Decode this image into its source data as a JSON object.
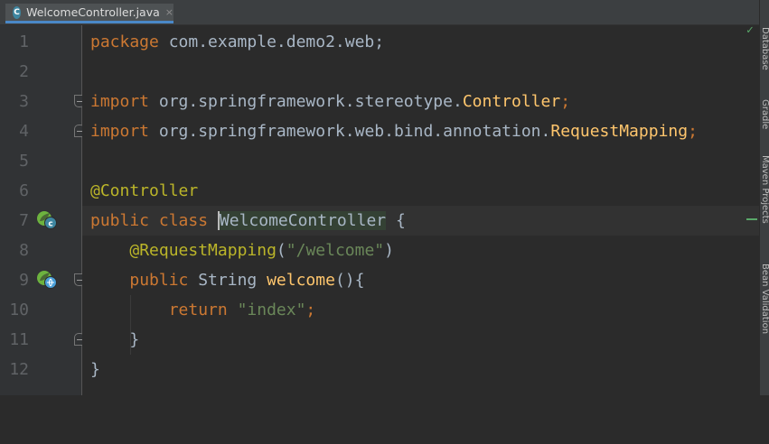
{
  "tab": {
    "icon_letter": "C",
    "file_name": "WelcomeController.java",
    "close_glyph": "×"
  },
  "gutter": {
    "line_numbers": [
      "1",
      "2",
      "3",
      "4",
      "5",
      "6",
      "7",
      "8",
      "9",
      "10",
      "11",
      "12"
    ]
  },
  "code": {
    "l1_kw": "package",
    "l1_rest": " com.example.demo2.web;",
    "l3_kw": "import",
    "l3_pkg": " org.springframework.stereotype.",
    "l3_cls": "Controller",
    "l3_semi": ";",
    "l4_kw": "import",
    "l4_pkg": " org.springframework.web.bind.annotation.",
    "l4_cls": "RequestMapping",
    "l4_semi": ";",
    "l6_ann": "@Controller",
    "l7_kw": "public class ",
    "l7_name": "WelcomeController",
    "l7_brace": " {",
    "l8_indent": "    ",
    "l8_ann": "@RequestMapping",
    "l8_open": "(",
    "l8_str": "\"/welcome\"",
    "l8_close": ")",
    "l9_indent": "    ",
    "l9_kw": "public ",
    "l9_type": "String ",
    "l9_fn": "welcome",
    "l9_rest": "(){",
    "l10_indent": "        ",
    "l10_kw": "return ",
    "l10_str": "\"index\"",
    "l10_semi": ";",
    "l11_text": "    }",
    "l12_text": "}"
  },
  "right_panel": {
    "tabs": [
      "Database",
      "Gradle",
      "Maven Projects",
      "Bean Validation"
    ]
  },
  "status": {
    "check_glyph": "✓"
  },
  "colors": {
    "background": "#2b2b2b",
    "keyword": "#cc7832",
    "annotation": "#bbb529",
    "string": "#6a8759",
    "function": "#ffc66d",
    "text": "#a9b7c6",
    "line_number": "#606366"
  }
}
